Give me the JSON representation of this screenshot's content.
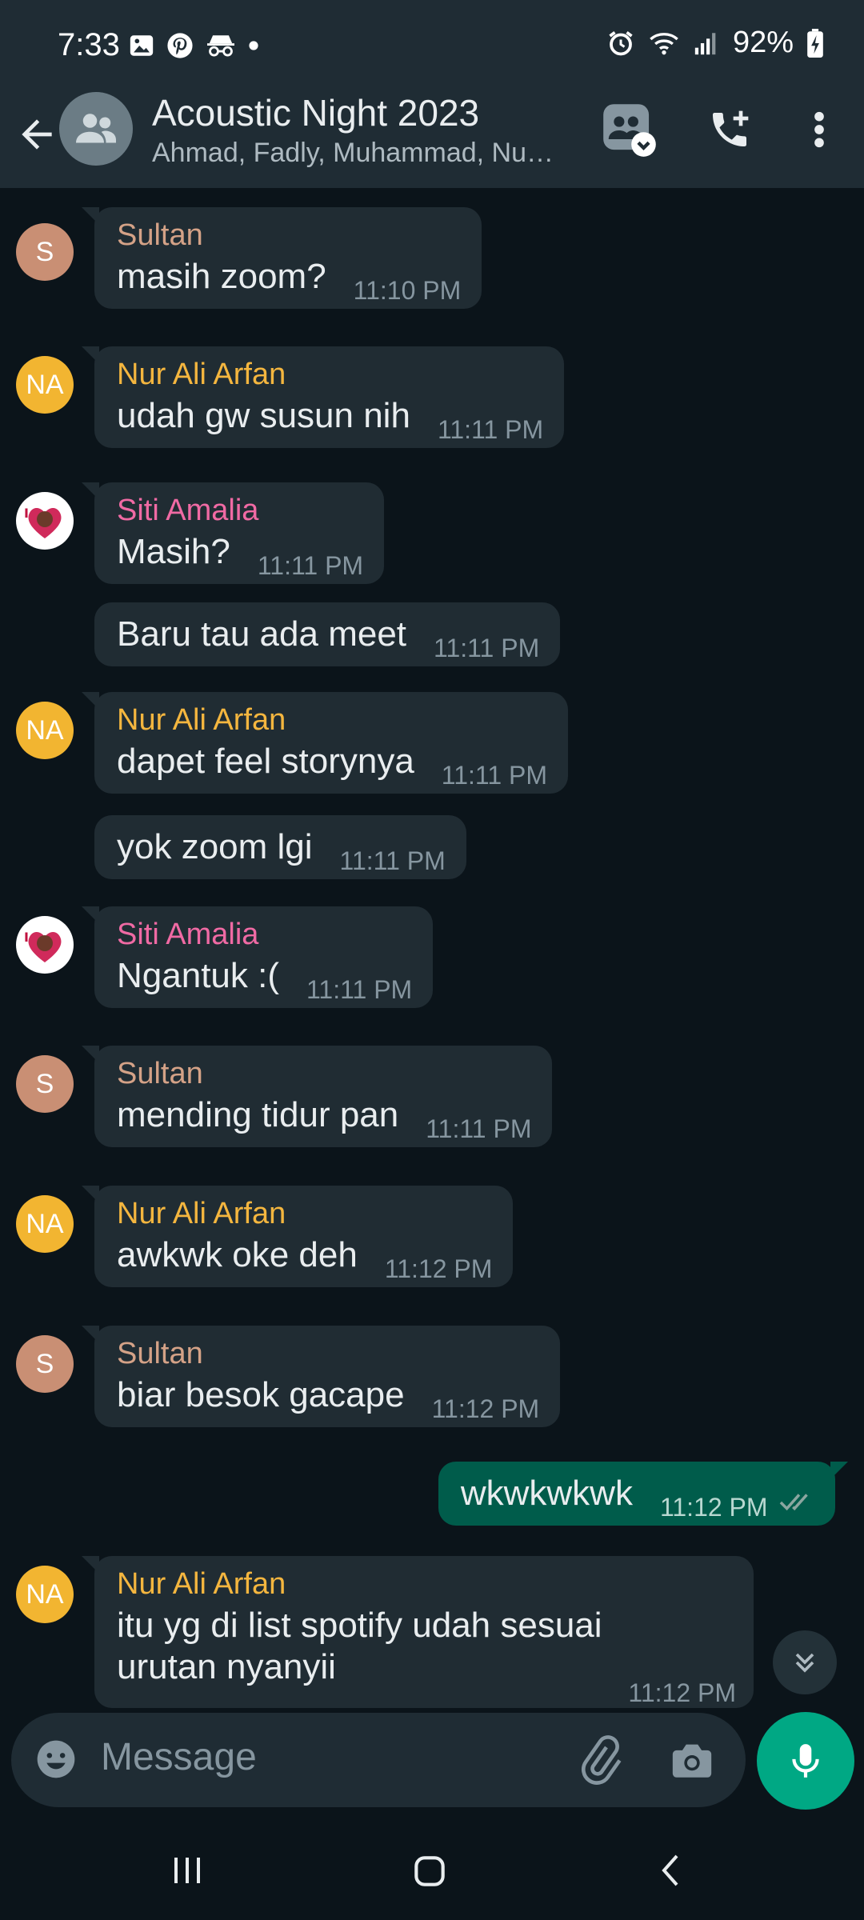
{
  "status_bar": {
    "time": "7:33",
    "battery": "92%",
    "left_icons": [
      "gallery-icon",
      "pinterest-icon",
      "incognito-icon",
      "dot-icon"
    ],
    "right_icons": [
      "alarm-icon",
      "wifi-icon",
      "signal-icon",
      "battery-charging-icon"
    ]
  },
  "header": {
    "title": "Acoustic Night 2023",
    "subtitle": "Ahmad, Fadly, Muhammad, Nu…",
    "icons": [
      "back-arrow-icon",
      "group-avatar-icon",
      "community-icon",
      "add-call-icon",
      "more-vert-icon"
    ]
  },
  "colors": {
    "background": "#0b141a",
    "bar": "#1f2c34",
    "incoming_bubble": "#202c33",
    "outgoing_bubble": "#005c4b",
    "accent": "#00a884",
    "sultan": "#d4a287",
    "nur_ali_arfan": "#f4b63f",
    "siti_amalia": "#f06aa4"
  },
  "messages": [
    {
      "sender": "Sultan",
      "avatar": "S",
      "text": "masih zoom?",
      "time": "11:10 PM"
    },
    {
      "sender": "Nur Ali Arfan",
      "avatar": "NA",
      "text": "udah gw susun nih",
      "time": "11:11 PM"
    },
    {
      "sender": "Siti Amalia",
      "avatar": "siti-avatar-image",
      "text": "Masih?",
      "time": "11:11 PM"
    },
    {
      "sender": "",
      "text": "Baru tau ada meet",
      "time": "11:11 PM"
    },
    {
      "sender": "Nur Ali Arfan",
      "avatar": "NA",
      "text": "dapet feel storynya",
      "time": "11:11 PM"
    },
    {
      "sender": "",
      "text": "yok zoom lgi",
      "time": "11:11 PM"
    },
    {
      "sender": "Siti Amalia",
      "avatar": "siti-avatar-image",
      "text": "Ngantuk :(",
      "time": "11:11 PM"
    },
    {
      "sender": "Sultan",
      "avatar": "S",
      "text": "mending tidur pan",
      "time": "11:11 PM"
    },
    {
      "sender": "Nur Ali Arfan",
      "avatar": "NA",
      "text": "awkwk oke deh",
      "time": "11:12 PM"
    },
    {
      "sender": "Sultan",
      "avatar": "S",
      "text": "biar besok gacape",
      "time": "11:12 PM"
    },
    {
      "sender": "me",
      "text": "wkwkwkwk",
      "time": "11:12 PM",
      "status": "double-check-icon"
    },
    {
      "sender": "Nur Ali Arfan",
      "avatar": "NA",
      "text_line1": "itu yg di list spotify udah sesuai",
      "text_line2": "urutan nyanyii",
      "time": "11:12 PM"
    }
  ],
  "input": {
    "placeholder": "Message",
    "icons": [
      "emoji-icon",
      "attach-icon",
      "camera-icon",
      "mic-icon"
    ]
  },
  "navbar": {
    "icons": [
      "recent-apps-icon",
      "home-icon",
      "back-nav-icon"
    ]
  }
}
